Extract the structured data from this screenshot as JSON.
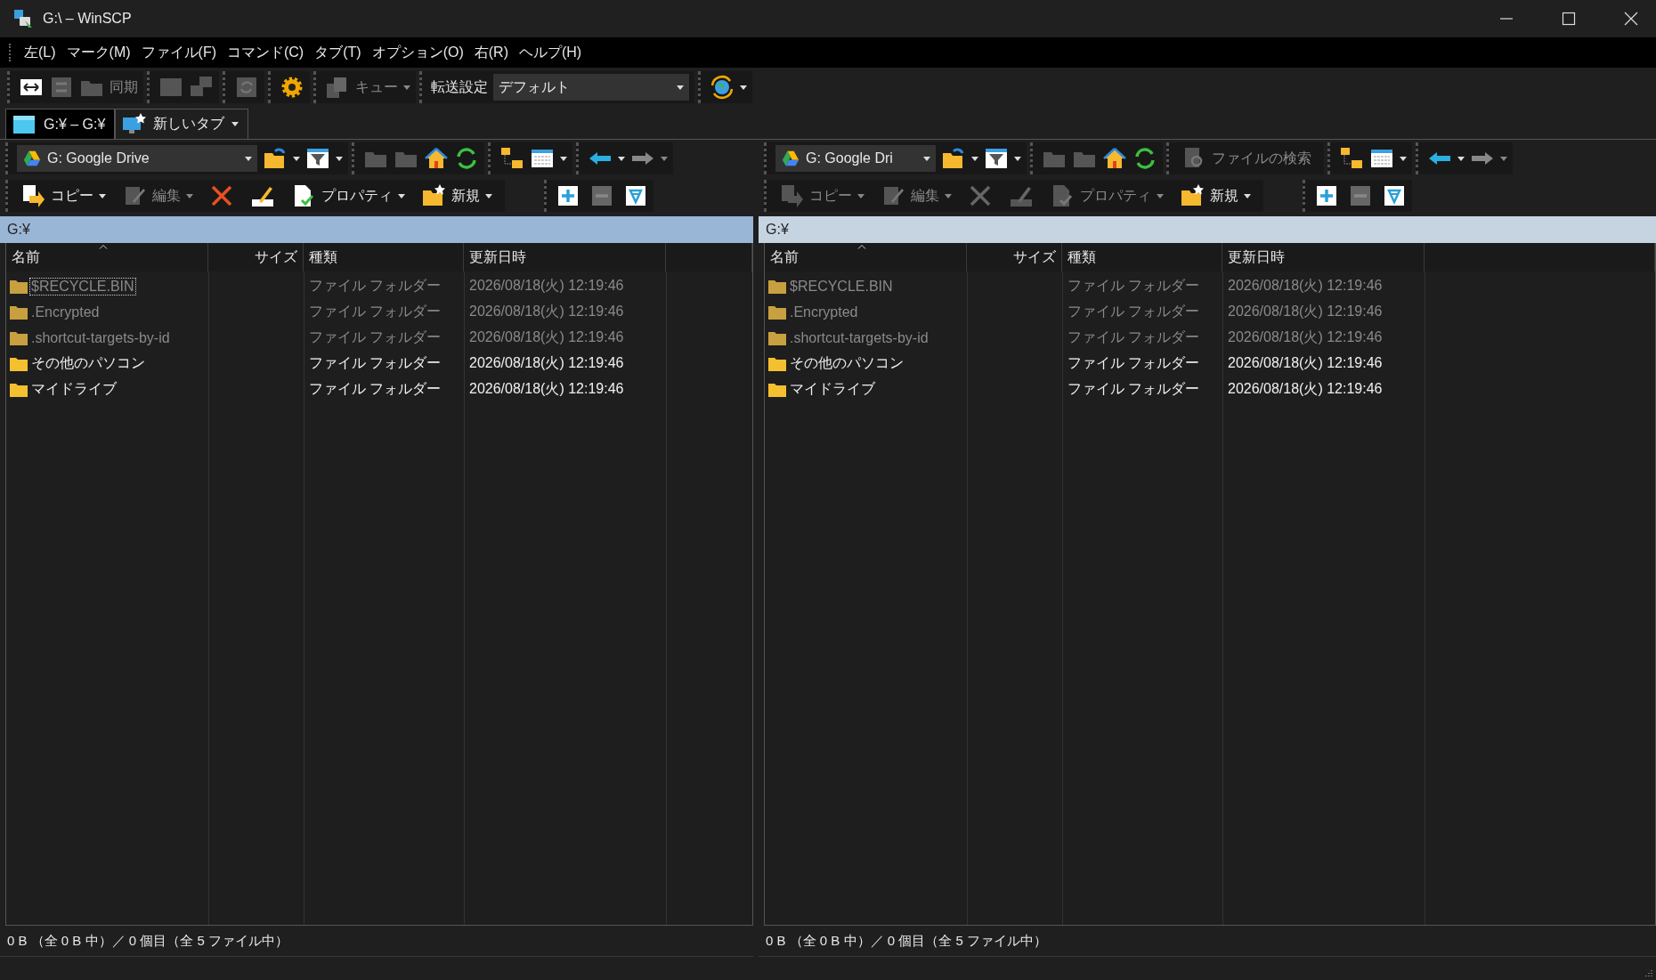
{
  "window": {
    "title": "G:\\ – WinSCP"
  },
  "menu": [
    "左(L)",
    "マーク(M)",
    "ファイル(F)",
    "コマンド(C)",
    "タブ(T)",
    "オプション(O)",
    "右(R)",
    "ヘルプ(H)"
  ],
  "toolbar": {
    "sync_label": "同期",
    "queue_label": "キュー",
    "transfer_label": "転送設定",
    "transfer_value": "デフォルト"
  },
  "tabs": [
    {
      "label": "G:¥ – G:¥",
      "selected": true
    },
    {
      "label": "新しいタブ",
      "selected": false
    }
  ],
  "panels": [
    {
      "drive": "G: Google Drive",
      "active": true,
      "path": "G:¥",
      "buttons": [
        {
          "kind": "copy",
          "label": "コピー",
          "disabled": false
        },
        {
          "kind": "edit",
          "label": "編集",
          "disabled": true
        },
        {
          "kind": "delete",
          "disabled": false
        },
        {
          "kind": "rename",
          "disabled": false
        },
        {
          "kind": "properties",
          "label": "プロパティ",
          "disabled": false
        },
        {
          "kind": "new",
          "label": "新規",
          "disabled": false
        }
      ],
      "columns": [
        "名前",
        "サイズ",
        "種類",
        "更新日時"
      ],
      "rows": [
        {
          "name": "$RECYCLE.BIN",
          "type": "ファイル フォルダー",
          "date": "2026/08/18(火) 12:19:46",
          "hidden": true,
          "focused": true
        },
        {
          "name": ".Encrypted",
          "type": "ファイル フォルダー",
          "date": "2026/08/18(火) 12:19:46",
          "hidden": true,
          "focused": false
        },
        {
          "name": ".shortcut-targets-by-id",
          "type": "ファイル フォルダー",
          "date": "2026/08/18(火) 12:19:46",
          "hidden": true,
          "focused": false
        },
        {
          "name": "その他のパソコン",
          "type": "ファイル フォルダー",
          "date": "2026/08/18(火) 12:19:46",
          "hidden": false,
          "focused": false
        },
        {
          "name": "マイドライブ",
          "type": "ファイル フォルダー",
          "date": "2026/08/18(火) 12:19:46",
          "hidden": false,
          "focused": false
        }
      ],
      "status": "0 B （全 0 B 中）／ 0 個目（全 5 ファイル中）"
    },
    {
      "drive": "G: Google Dri",
      "find_label": "ファイルの検索",
      "active": false,
      "path": "G:¥",
      "buttons": [
        {
          "kind": "copy",
          "label": "コピー",
          "disabled": true
        },
        {
          "kind": "edit",
          "label": "編集",
          "disabled": true
        },
        {
          "kind": "delete",
          "disabled": true
        },
        {
          "kind": "rename",
          "disabled": true
        },
        {
          "kind": "properties",
          "label": "プロパティ",
          "disabled": true
        },
        {
          "kind": "new",
          "label": "新規",
          "disabled": false
        }
      ],
      "columns": [
        "名前",
        "サイズ",
        "種類",
        "更新日時"
      ],
      "rows": [
        {
          "name": "$RECYCLE.BIN",
          "type": "ファイル フォルダー",
          "date": "2026/08/18(火) 12:19:46",
          "hidden": true,
          "focused": false
        },
        {
          "name": ".Encrypted",
          "type": "ファイル フォルダー",
          "date": "2026/08/18(火) 12:19:46",
          "hidden": true,
          "focused": false
        },
        {
          "name": ".shortcut-targets-by-id",
          "type": "ファイル フォルダー",
          "date": "2026/08/18(火) 12:19:46",
          "hidden": true,
          "focused": false
        },
        {
          "name": "その他のパソコン",
          "type": "ファイル フォルダー",
          "date": "2026/08/18(火) 12:19:46",
          "hidden": false,
          "focused": false
        },
        {
          "name": "マイドライブ",
          "type": "ファイル フォルダー",
          "date": "2026/08/18(火) 12:19:46",
          "hidden": false,
          "focused": false
        }
      ],
      "status": "0 B （全 0 B 中）／ 0 個目（全 5 ファイル中）"
    }
  ]
}
